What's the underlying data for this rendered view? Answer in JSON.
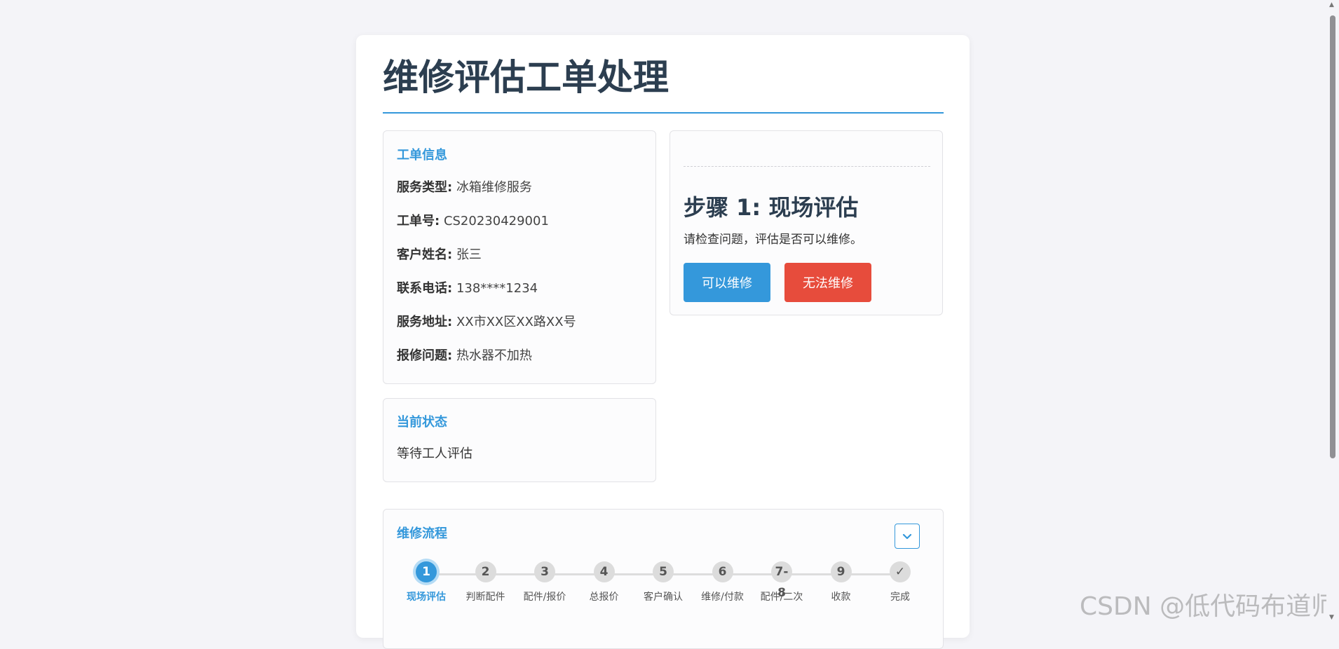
{
  "page": {
    "title": "维修评估工单处理"
  },
  "order_info": {
    "heading": "工单信息",
    "rows": [
      {
        "label": "服务类型:",
        "value": "冰箱维修服务"
      },
      {
        "label": "工单号:",
        "value": "CS20230429001"
      },
      {
        "label": "客户姓名:",
        "value": "张三"
      },
      {
        "label": "联系电话:",
        "value": "138****1234"
      },
      {
        "label": "服务地址:",
        "value": "XX市XX区XX路XX号"
      },
      {
        "label": "报修问题:",
        "value": "热水器不加热"
      }
    ]
  },
  "status": {
    "heading": "当前状态",
    "text": "等待工人评估"
  },
  "current_step": {
    "title": "步骤 1: 现场评估",
    "description": "请检查问题，评估是否可以维修。",
    "yes_label": "可以维修",
    "no_label": "无法维修",
    "colors": {
      "yes": "#3498db",
      "no": "#e74c3c"
    }
  },
  "flow": {
    "heading": "维修流程",
    "toggle_icon": "chevron-down-icon",
    "active_index": 0,
    "steps": [
      {
        "num": "1",
        "label": "现场评估"
      },
      {
        "num": "2",
        "label": "判断配件"
      },
      {
        "num": "3",
        "label": "配件/报价"
      },
      {
        "num": "4",
        "label": "总报价"
      },
      {
        "num": "5",
        "label": "客户确认"
      },
      {
        "num": "6",
        "label": "维修/付款"
      },
      {
        "num": "7-8",
        "label": "配件/二次"
      },
      {
        "num": "9",
        "label": "收款"
      },
      {
        "num": "✓",
        "label": "完成"
      }
    ]
  },
  "watermark": "CSDN @低代码布道师",
  "accent_color": "#3498db"
}
